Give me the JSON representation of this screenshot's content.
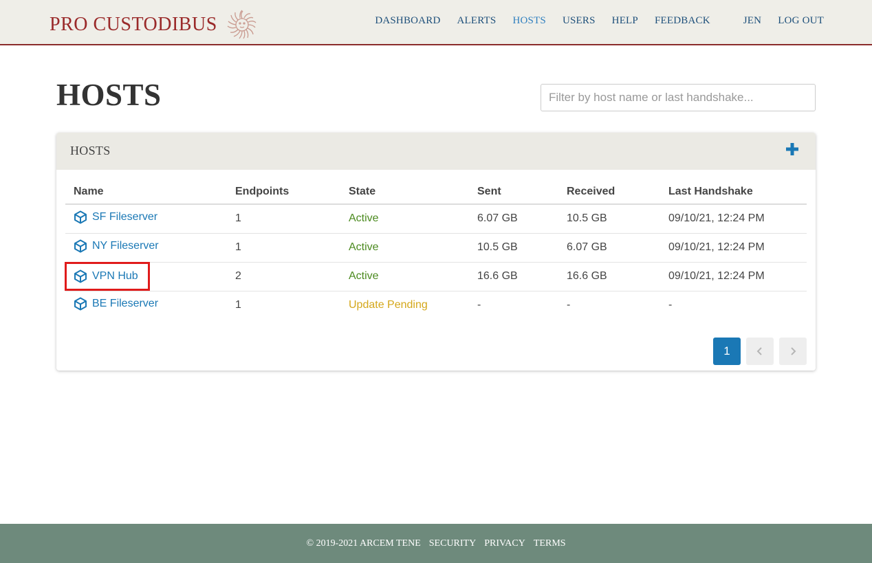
{
  "brand": {
    "name": "PRO CUSTODIBUS"
  },
  "nav": {
    "items": [
      {
        "label": "DASHBOARD",
        "active": false
      },
      {
        "label": "ALERTS",
        "active": false
      },
      {
        "label": "HOSTS",
        "active": true
      },
      {
        "label": "USERS",
        "active": false
      },
      {
        "label": "HELP",
        "active": false
      },
      {
        "label": "FEEDBACK",
        "active": false
      }
    ],
    "user": "JEN",
    "logout": "LOG OUT"
  },
  "page": {
    "title": "HOSTS",
    "filter_placeholder": "Filter by host name or last handshake..."
  },
  "card": {
    "title": "HOSTS",
    "add_icon": "plus-icon"
  },
  "table": {
    "columns": [
      "Name",
      "Endpoints",
      "State",
      "Sent",
      "Received",
      "Last Handshake"
    ],
    "rows": [
      {
        "name": "SF Fileserver",
        "endpoints": "1",
        "state": "Active",
        "sent": "6.07 GB",
        "received": "10.5 GB",
        "last_handshake": "09/10/21, 12:24 PM"
      },
      {
        "name": "NY Fileserver",
        "endpoints": "1",
        "state": "Active",
        "sent": "10.5 GB",
        "received": "6.07 GB",
        "last_handshake": "09/10/21, 12:24 PM"
      },
      {
        "name": "VPN Hub",
        "endpoints": "2",
        "state": "Active",
        "sent": "16.6 GB",
        "received": "16.6 GB",
        "last_handshake": "09/10/21, 12:24 PM"
      },
      {
        "name": "BE Fileserver",
        "endpoints": "1",
        "state": "Update Pending",
        "sent": "-",
        "received": "-",
        "last_handshake": "-"
      }
    ],
    "row_icon": "cube-icon"
  },
  "pagination": {
    "current": "1",
    "prev_icon": "chevron-left-icon",
    "next_icon": "chevron-right-icon"
  },
  "footer": {
    "copyright": "© 2019-2021 ARCEM TENE",
    "links": [
      "SECURITY",
      "PRIVACY",
      "TERMS"
    ]
  },
  "colors": {
    "brand": "#9a2a2a",
    "link": "#1a78b5",
    "active_state": "#4b8a1f",
    "pending_state": "#d4a71a",
    "footer_bg": "#6e8a7c",
    "highlight": "#e01b1b"
  }
}
